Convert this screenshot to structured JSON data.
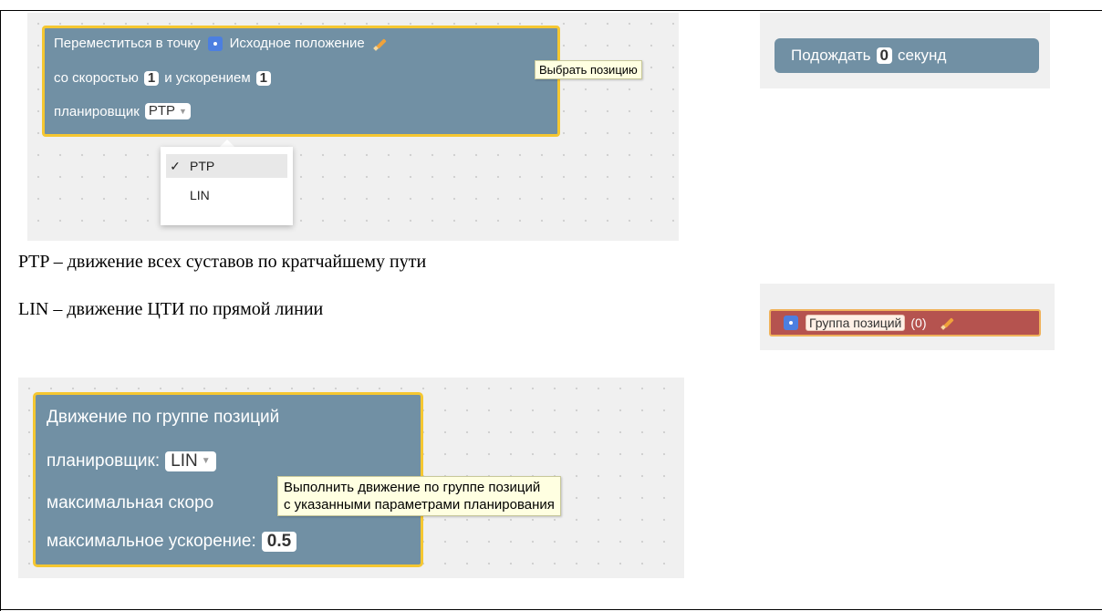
{
  "move_block": {
    "line1_prefix": "Переместиться в точку",
    "position_name": "Исходное положение",
    "line2_prefix": "со скоростью",
    "speed": "1",
    "line2_mid": "и ускорением",
    "accel": "1",
    "line3_prefix": "планировщик",
    "planner": "PTP",
    "tooltip": "Выбрать позицию",
    "menu": [
      {
        "label": "PTP",
        "selected": true,
        "check": "✓"
      },
      {
        "label": "LIN",
        "selected": false,
        "check": ""
      }
    ]
  },
  "wait_block": {
    "prefix": "Подождать",
    "value": "0",
    "suffix": "секунд"
  },
  "descriptions": [
    "PTP – движение всех суставов по кратчайшему пути",
    "LIN – движение ЦТИ по прямой линии"
  ],
  "group_block": {
    "name": "Группа позиций",
    "count": "(0)"
  },
  "group_move_block": {
    "title": "Движение по группе позиций",
    "planner_label": "планировщик:",
    "planner": "LIN",
    "max_speed_label": "максимальная скоро",
    "max_accel_label": "максимальное ускорение:",
    "max_accel": "0.5",
    "tooltip_line1": "Выполнить движение по группе позиций",
    "tooltip_line2": "с указанными параметрами планирования"
  },
  "colors": {
    "block": "#7190a4",
    "selected_border": "#f5c731",
    "group_block": "#b5534f",
    "tooltip_bg": "#ffffe1"
  }
}
